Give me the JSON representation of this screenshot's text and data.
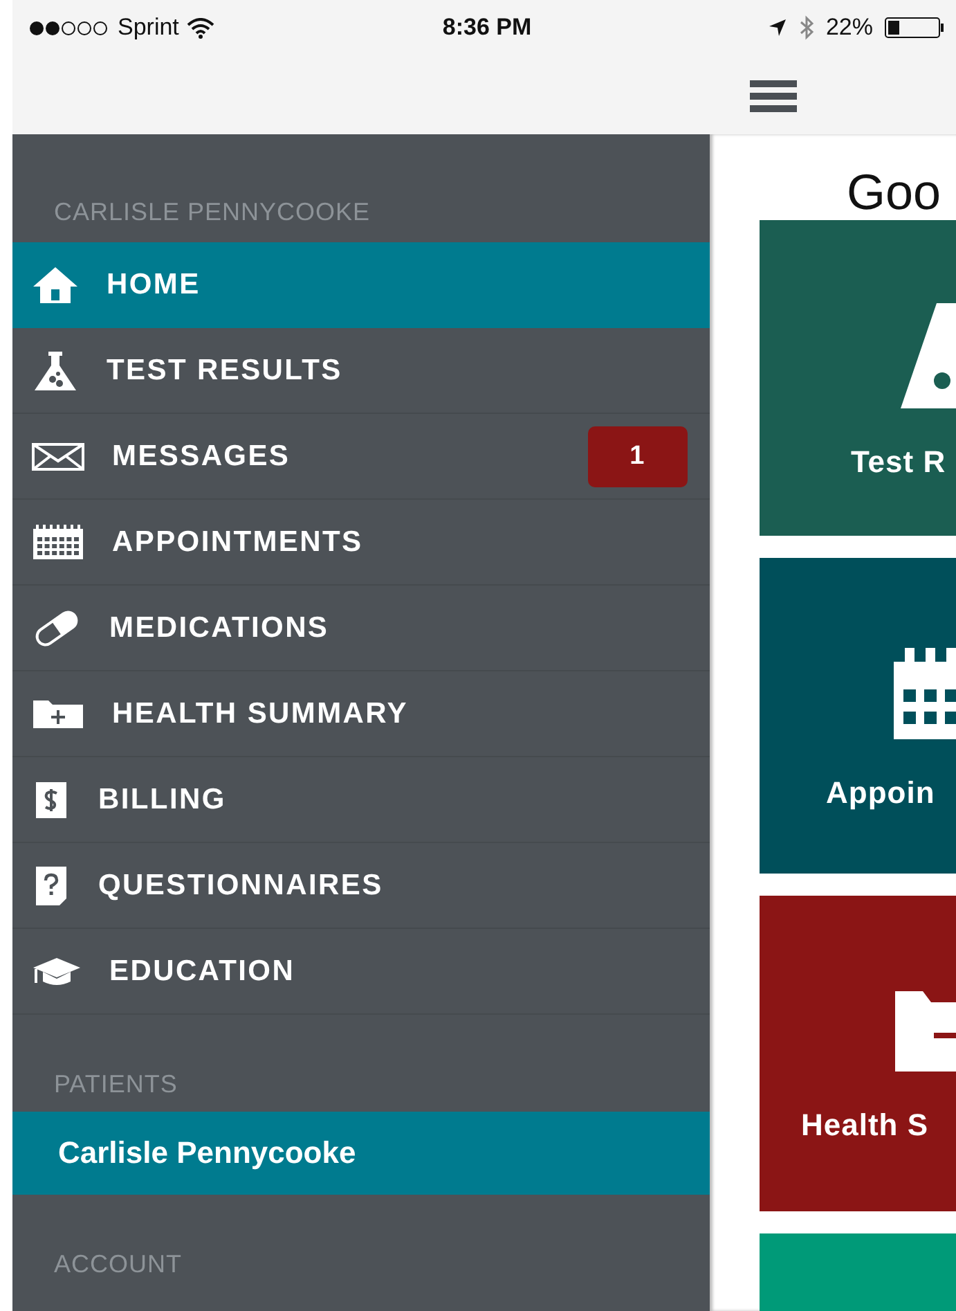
{
  "status_bar": {
    "carrier": "Sprint",
    "time": "8:36 PM",
    "battery": "22%"
  },
  "drawer": {
    "account_name": "CARLISLE PENNYCOOKE",
    "items": [
      {
        "label": "HOME",
        "selected": true
      },
      {
        "label": "TEST RESULTS",
        "selected": false
      },
      {
        "label": "MESSAGES",
        "selected": false,
        "badge": "1"
      },
      {
        "label": "APPOINTMENTS",
        "selected": false
      },
      {
        "label": "MEDICATIONS",
        "selected": false
      },
      {
        "label": "HEALTH SUMMARY",
        "selected": false
      },
      {
        "label": "BILLING",
        "selected": false
      },
      {
        "label": "QUESTIONNAIRES",
        "selected": false
      },
      {
        "label": "EDUCATION",
        "selected": false
      }
    ],
    "patients_header": "PATIENTS",
    "patients": [
      {
        "name": "Carlisle Pennycooke",
        "selected": true
      }
    ],
    "account_header": "ACCOUNT"
  },
  "main": {
    "greeting": "Goo",
    "tiles": [
      {
        "label": "Test R",
        "color": "#1b5e52"
      },
      {
        "label": "Appoin",
        "color": "#004f5a"
      },
      {
        "label": "Health S",
        "color": "#8b1515"
      },
      {
        "color": "#009a78"
      }
    ]
  }
}
